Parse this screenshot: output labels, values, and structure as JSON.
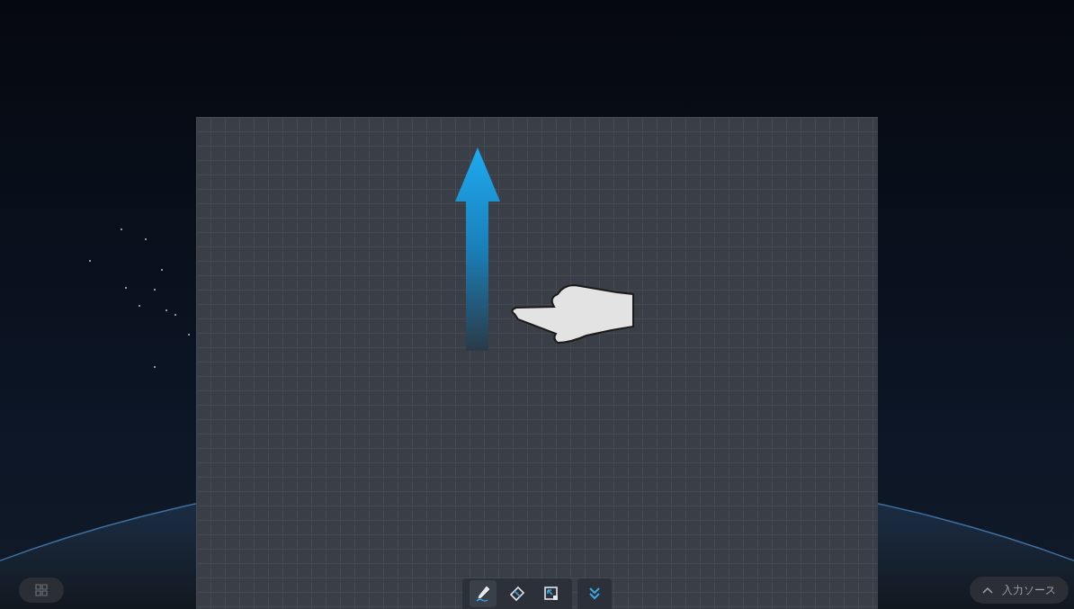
{
  "toolbar": {
    "tools": [
      {
        "kind": "pen",
        "selected": true
      },
      {
        "kind": "eraser",
        "selected": false
      },
      {
        "kind": "select",
        "selected": false
      }
    ]
  },
  "input_source": {
    "label": "入力ソース"
  }
}
